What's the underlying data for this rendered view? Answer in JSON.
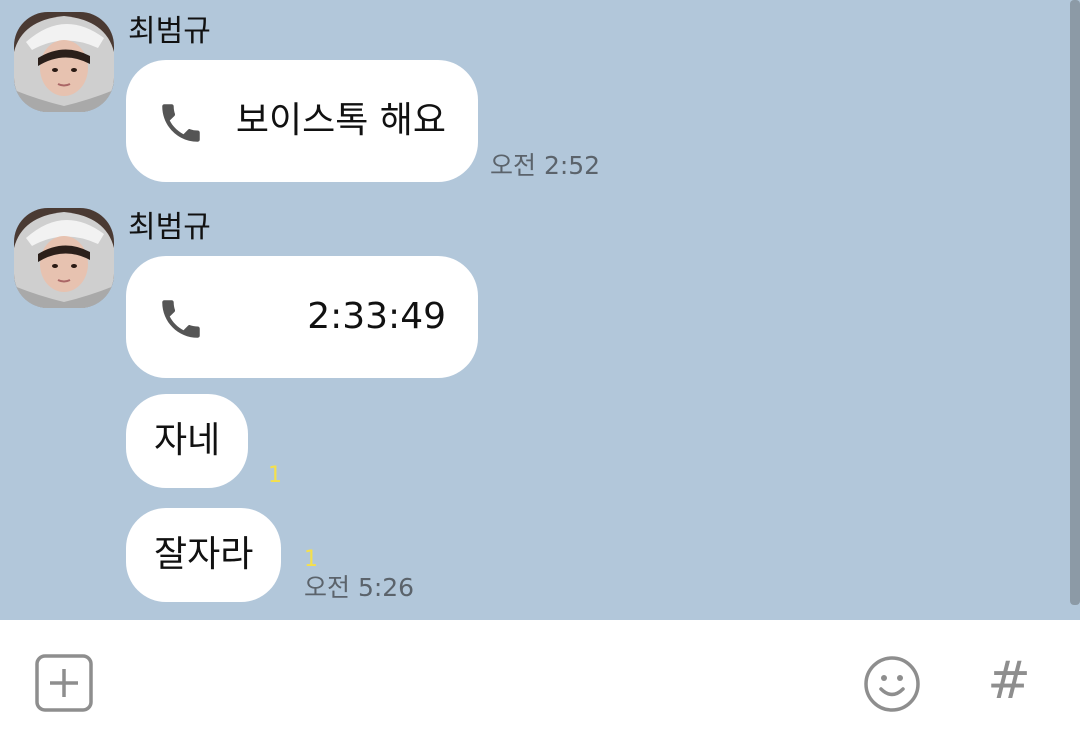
{
  "messages": [
    {
      "sender": "최범규",
      "type": "call",
      "text": "보이스톡 해요",
      "time": "오전 2:52"
    },
    {
      "sender": "최범규",
      "type": "call",
      "text": "2:33:49"
    },
    {
      "type": "text",
      "text": "자네",
      "unread": "1"
    },
    {
      "type": "text",
      "text": "잘자라",
      "unread": "1",
      "time": "오전 5:26"
    }
  ],
  "colors": {
    "chat_background": "#b2c7da",
    "bubble": "#ffffff",
    "unread": "#f5e04b",
    "time": "#5b636b"
  },
  "input_bar": {
    "plus_icon": "plus-square-icon",
    "emoji_icon": "smiley-icon",
    "hash_label": "#"
  }
}
